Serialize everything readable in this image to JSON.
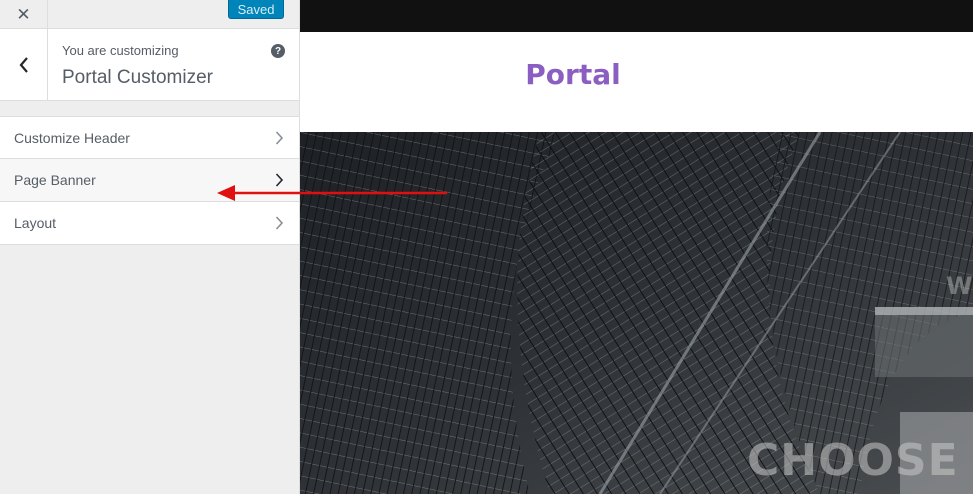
{
  "sidebar": {
    "close_symbol": "✕",
    "saved_label": "Saved",
    "info_subtitle": "You are customizing",
    "info_title": "Portal Customizer",
    "help_symbol": "?",
    "items": [
      {
        "label": "Customize Header"
      },
      {
        "label": "Page Banner"
      },
      {
        "label": "Layout"
      }
    ]
  },
  "preview": {
    "site_title": "Portal",
    "banner_text": "CHOOSE Y",
    "banner_side_text": "W"
  },
  "colors": {
    "accent": "#0085ba",
    "site_title": "#8a5fc1",
    "annotation_arrow": "#e01010"
  },
  "icons": {
    "close": "close-icon",
    "back": "chevron-left-icon",
    "help": "help-icon",
    "item_chevron": "chevron-right-icon"
  }
}
